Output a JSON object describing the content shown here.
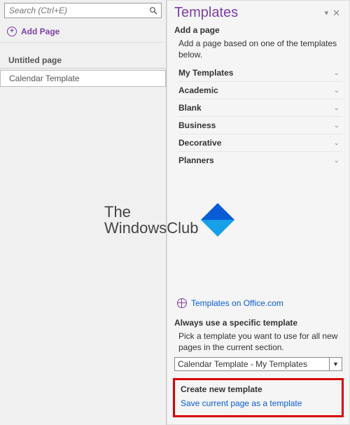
{
  "left": {
    "search_placeholder": "Search (Ctrl+E)",
    "add_page_label": "Add Page",
    "pages": {
      "untitled": "Untitled page",
      "current": "Calendar Template"
    }
  },
  "pane": {
    "title": "Templates",
    "dropdown_glyph": "▾",
    "close_glyph": "✕"
  },
  "add_section": {
    "heading": "Add a page",
    "description": "Add a page based on one of the templates below."
  },
  "categories": [
    {
      "label": "My Templates"
    },
    {
      "label": "Academic"
    },
    {
      "label": "Blank"
    },
    {
      "label": "Business"
    },
    {
      "label": "Decorative"
    },
    {
      "label": "Planners"
    }
  ],
  "chevron": "⌄",
  "office_link": "Templates on Office.com",
  "always": {
    "heading": "Always use a specific template",
    "description": "Pick a template you want to use for all new pages in the current section.",
    "selected": "Calendar Template - My Templates",
    "arrow": "▼"
  },
  "create": {
    "heading": "Create new template",
    "link": "Save current page as a template"
  },
  "watermark": {
    "line1": "The",
    "line2": "WindowsClub"
  }
}
